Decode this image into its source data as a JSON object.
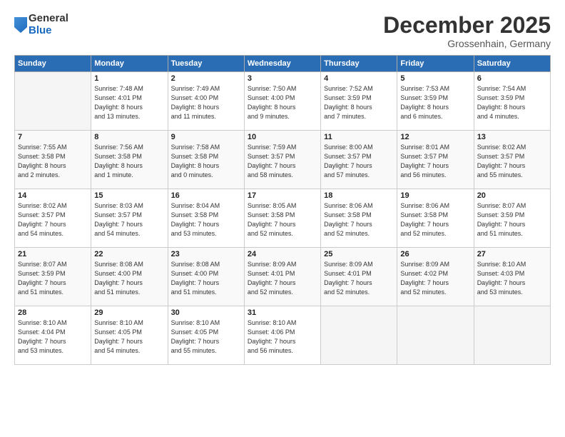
{
  "logo": {
    "general": "General",
    "blue": "Blue"
  },
  "title": "December 2025",
  "subtitle": "Grossenhain, Germany",
  "header_days": [
    "Sunday",
    "Monday",
    "Tuesday",
    "Wednesday",
    "Thursday",
    "Friday",
    "Saturday"
  ],
  "weeks": [
    [
      {
        "day": "",
        "info": ""
      },
      {
        "day": "1",
        "info": "Sunrise: 7:48 AM\nSunset: 4:01 PM\nDaylight: 8 hours\nand 13 minutes."
      },
      {
        "day": "2",
        "info": "Sunrise: 7:49 AM\nSunset: 4:00 PM\nDaylight: 8 hours\nand 11 minutes."
      },
      {
        "day": "3",
        "info": "Sunrise: 7:50 AM\nSunset: 4:00 PM\nDaylight: 8 hours\nand 9 minutes."
      },
      {
        "day": "4",
        "info": "Sunrise: 7:52 AM\nSunset: 3:59 PM\nDaylight: 8 hours\nand 7 minutes."
      },
      {
        "day": "5",
        "info": "Sunrise: 7:53 AM\nSunset: 3:59 PM\nDaylight: 8 hours\nand 6 minutes."
      },
      {
        "day": "6",
        "info": "Sunrise: 7:54 AM\nSunset: 3:59 PM\nDaylight: 8 hours\nand 4 minutes."
      }
    ],
    [
      {
        "day": "7",
        "info": "Sunrise: 7:55 AM\nSunset: 3:58 PM\nDaylight: 8 hours\nand 2 minutes."
      },
      {
        "day": "8",
        "info": "Sunrise: 7:56 AM\nSunset: 3:58 PM\nDaylight: 8 hours\nand 1 minute."
      },
      {
        "day": "9",
        "info": "Sunrise: 7:58 AM\nSunset: 3:58 PM\nDaylight: 8 hours\nand 0 minutes."
      },
      {
        "day": "10",
        "info": "Sunrise: 7:59 AM\nSunset: 3:57 PM\nDaylight: 7 hours\nand 58 minutes."
      },
      {
        "day": "11",
        "info": "Sunrise: 8:00 AM\nSunset: 3:57 PM\nDaylight: 7 hours\nand 57 minutes."
      },
      {
        "day": "12",
        "info": "Sunrise: 8:01 AM\nSunset: 3:57 PM\nDaylight: 7 hours\nand 56 minutes."
      },
      {
        "day": "13",
        "info": "Sunrise: 8:02 AM\nSunset: 3:57 PM\nDaylight: 7 hours\nand 55 minutes."
      }
    ],
    [
      {
        "day": "14",
        "info": "Sunrise: 8:02 AM\nSunset: 3:57 PM\nDaylight: 7 hours\nand 54 minutes."
      },
      {
        "day": "15",
        "info": "Sunrise: 8:03 AM\nSunset: 3:57 PM\nDaylight: 7 hours\nand 54 minutes."
      },
      {
        "day": "16",
        "info": "Sunrise: 8:04 AM\nSunset: 3:58 PM\nDaylight: 7 hours\nand 53 minutes."
      },
      {
        "day": "17",
        "info": "Sunrise: 8:05 AM\nSunset: 3:58 PM\nDaylight: 7 hours\nand 52 minutes."
      },
      {
        "day": "18",
        "info": "Sunrise: 8:06 AM\nSunset: 3:58 PM\nDaylight: 7 hours\nand 52 minutes."
      },
      {
        "day": "19",
        "info": "Sunrise: 8:06 AM\nSunset: 3:58 PM\nDaylight: 7 hours\nand 52 minutes."
      },
      {
        "day": "20",
        "info": "Sunrise: 8:07 AM\nSunset: 3:59 PM\nDaylight: 7 hours\nand 51 minutes."
      }
    ],
    [
      {
        "day": "21",
        "info": "Sunrise: 8:07 AM\nSunset: 3:59 PM\nDaylight: 7 hours\nand 51 minutes."
      },
      {
        "day": "22",
        "info": "Sunrise: 8:08 AM\nSunset: 4:00 PM\nDaylight: 7 hours\nand 51 minutes."
      },
      {
        "day": "23",
        "info": "Sunrise: 8:08 AM\nSunset: 4:00 PM\nDaylight: 7 hours\nand 51 minutes."
      },
      {
        "day": "24",
        "info": "Sunrise: 8:09 AM\nSunset: 4:01 PM\nDaylight: 7 hours\nand 52 minutes."
      },
      {
        "day": "25",
        "info": "Sunrise: 8:09 AM\nSunset: 4:01 PM\nDaylight: 7 hours\nand 52 minutes."
      },
      {
        "day": "26",
        "info": "Sunrise: 8:09 AM\nSunset: 4:02 PM\nDaylight: 7 hours\nand 52 minutes."
      },
      {
        "day": "27",
        "info": "Sunrise: 8:10 AM\nSunset: 4:03 PM\nDaylight: 7 hours\nand 53 minutes."
      }
    ],
    [
      {
        "day": "28",
        "info": "Sunrise: 8:10 AM\nSunset: 4:04 PM\nDaylight: 7 hours\nand 53 minutes."
      },
      {
        "day": "29",
        "info": "Sunrise: 8:10 AM\nSunset: 4:05 PM\nDaylight: 7 hours\nand 54 minutes."
      },
      {
        "day": "30",
        "info": "Sunrise: 8:10 AM\nSunset: 4:05 PM\nDaylight: 7 hours\nand 55 minutes."
      },
      {
        "day": "31",
        "info": "Sunrise: 8:10 AM\nSunset: 4:06 PM\nDaylight: 7 hours\nand 56 minutes."
      },
      {
        "day": "",
        "info": ""
      },
      {
        "day": "",
        "info": ""
      },
      {
        "day": "",
        "info": ""
      }
    ]
  ]
}
